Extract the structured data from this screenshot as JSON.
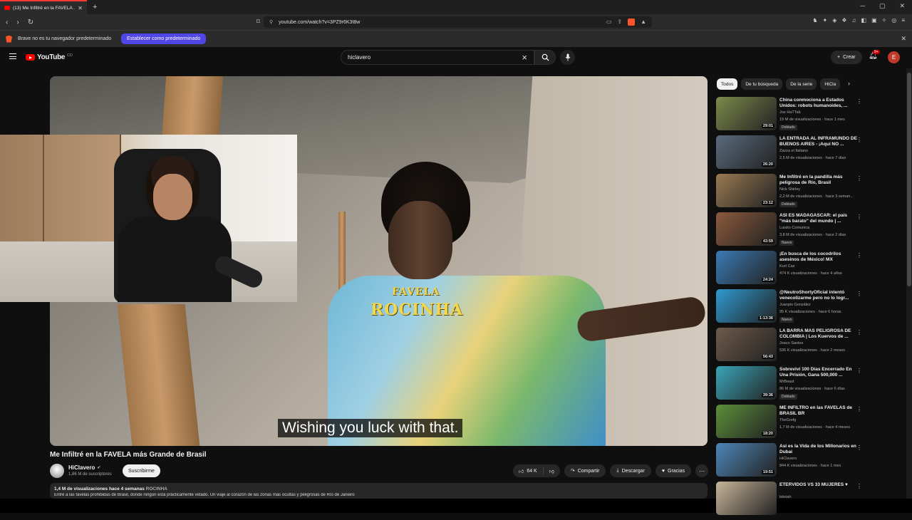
{
  "browser": {
    "tab_title": "(13) Me Infiltré en la FAVELA ...",
    "url": "youtube.com/watch?v=3PZ9r6K3t8w",
    "infobar_text": "Brave no es tu navegador predeterminado",
    "infobar_button": "Establecer como predeterminado",
    "ext_badge": "18"
  },
  "header": {
    "logo_text": "YouTube",
    "logo_country": "CO",
    "search_value": "hiclavero",
    "create_label": "Crear",
    "notifications_badge": "9+",
    "avatar_letter": "E"
  },
  "video": {
    "caption": "Wishing you luck with that.",
    "shirt_line1": "FAVELA",
    "shirt_line2": "ROCINHA",
    "title": "Me Infiltré en la FAVELA más Grande de Brasil",
    "channel": "HiClavero",
    "subscribers": "1,86 M de suscriptores",
    "subscribe_label": "Suscribirme",
    "likes": "64 K",
    "share_label": "Compartir",
    "download_label": "Descargar",
    "thanks_label": "Gracias",
    "views_date": "1,4 M de visualizaciones  hace 4 semanas",
    "tag": "ROCINHA",
    "description": "Entré a las favelas prohibidas de Brasil, donde ningún está prácticamente vetado. Un viaje al corazón de las zonas más ocultas y peligrosas de Río de Janeiro"
  },
  "chips": [
    "Todos",
    "De tu búsqueda",
    "De la serie",
    "HiCla"
  ],
  "recommendations": [
    {
      "title": "China conmociona a Estados Unidos: robots humanoides, ...",
      "channel": "Joe HaTTab",
      "meta": "19 M de visualizaciones · hace 1 mes",
      "badge": "Doblado",
      "duration": "29:01",
      "color": "#7d8a4a"
    },
    {
      "title": "LA ENTRADA AL INFRAMUNDO DE BUENOS AIRES - ¡Aquí NO ...",
      "channel": "Zazza el Italiano",
      "meta": "2,5 M de visualizaciones · hace 7 días",
      "badge": "",
      "duration": "26:20",
      "color": "#5a6b7d"
    },
    {
      "title": "Me Infiltré en la pandilla más peligrosa de Río, Brasil",
      "channel": "Nick Shirley",
      "meta": "2,2 M de visualizaciones · hace 3 seman...",
      "badge": "Doblado",
      "duration": "23:12",
      "color": "#9a7a52"
    },
    {
      "title": "ASÍ ES MADAGASCAR: el país \"más barato\" del mundo | ...",
      "channel": "Luisito Comunica",
      "meta": "3,8 M de visualizaciones · hace 2 días",
      "badge": "Nuevo",
      "duration": "43:59",
      "color": "#8b5a3c"
    },
    {
      "title": "¡En busca de los cocodrilos asesinos de México! MX",
      "channel": "Kurt Caz",
      "meta": "474 K visualizaciones · hace 4 años",
      "badge": "",
      "duration": "24:24",
      "color": "#3b7bb5"
    },
    {
      "title": "@NeutroShortyOficial intentó venecolizarme pero no lo logr...",
      "channel": "Juanpis González",
      "meta": "95 K visualizaciones · hace 6 horas",
      "badge": "Nuevo",
      "duration": "1:13:36",
      "color": "#2f9ad0"
    },
    {
      "title": "LA BARRA MAS PELIGROSA DE COLOMBIA | Los Kuervos de ...",
      "channel": "Joaco Santos",
      "meta": "536 K visualizaciones · hace 2 meses",
      "badge": "",
      "duration": "56:43",
      "color": "#6e5a4a"
    },
    {
      "title": "Sobreviví 100 Días Encerrado En Una Prisión, Gana 500,000 ...",
      "channel": "MrBeast",
      "meta": "86 M de visualizaciones · hace 6 días",
      "badge": "Doblado",
      "duration": "39:36",
      "color": "#3aa5b8"
    },
    {
      "title": "ME INFILTRO en las FAVELAS de BRASIL BR",
      "channel": "TheGrefg",
      "meta": "1,7 M de visualizaciones · hace 4 meses",
      "badge": "",
      "duration": "18:20",
      "color": "#5b8f3a"
    },
    {
      "title": "Así es la Vida de los Millonarios en Dubai",
      "channel": "HiClavero",
      "meta": "844 K visualizaciones · hace 1 mes",
      "badge": "",
      "duration": "19:51",
      "color": "#4f86b8"
    },
    {
      "title": "ETERVIDOS VS 33 MUJERES ♥",
      "channel": "lebriah",
      "meta": "",
      "badge": "",
      "duration": "",
      "color": "#c9b69a"
    }
  ]
}
